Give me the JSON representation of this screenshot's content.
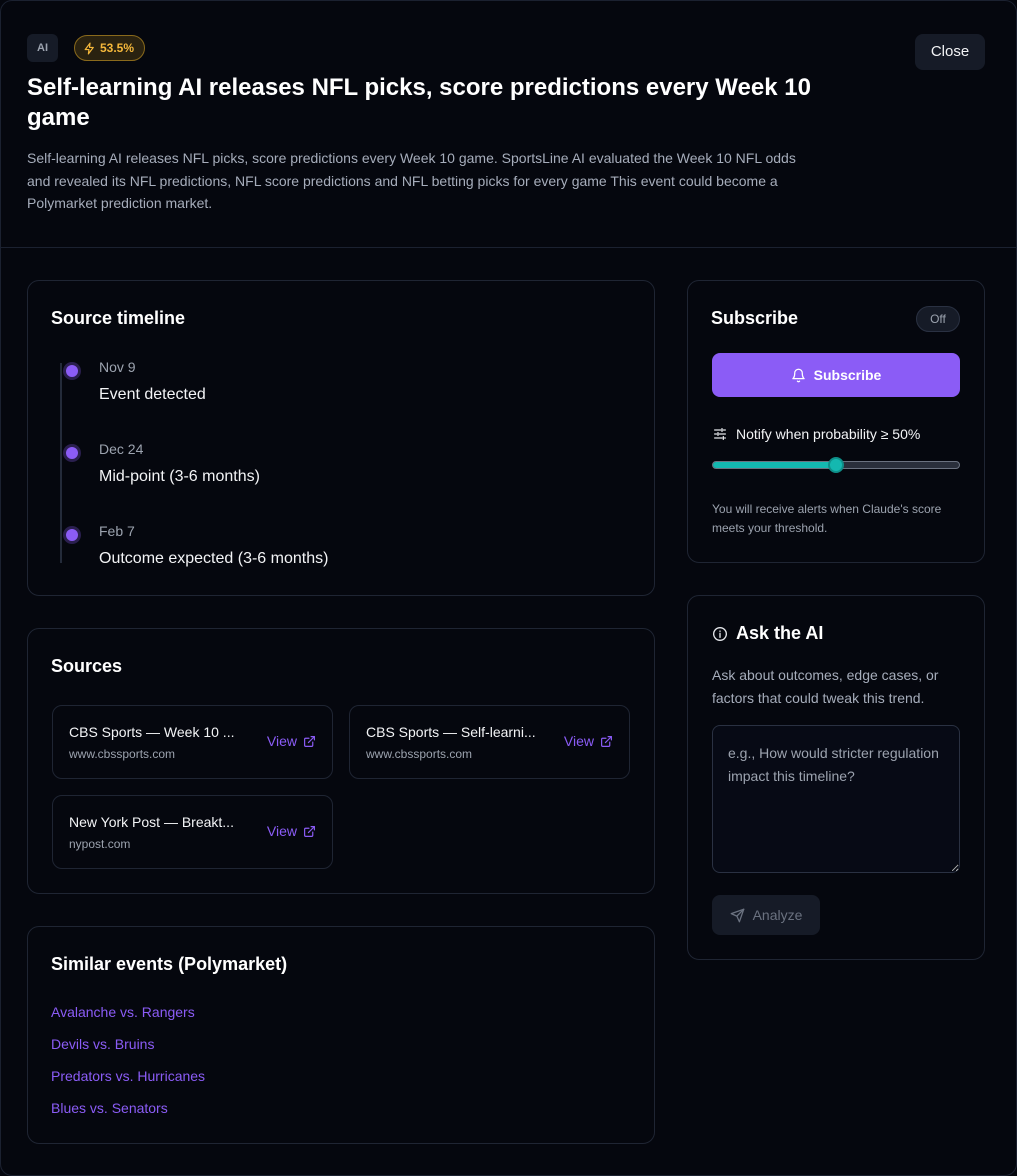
{
  "header": {
    "tag": "AI",
    "probability": "53.5%",
    "close_label": "Close",
    "title": "Self-learning AI releases NFL picks, score predictions every Week 10 game",
    "description": "Self-learning AI releases NFL picks, score predictions every Week 10 game. SportsLine AI evaluated the Week 10 NFL odds and revealed its NFL predictions, NFL score predictions and NFL betting picks for every game This event could become a Polymarket prediction market."
  },
  "timeline": {
    "title": "Source timeline",
    "items": [
      {
        "date": "Nov 9",
        "label": "Event detected"
      },
      {
        "date": "Dec 24",
        "label": "Mid-point (3-6 months)"
      },
      {
        "date": "Feb 7",
        "label": "Outcome expected (3-6 months)"
      }
    ]
  },
  "sources": {
    "title": "Sources",
    "items": [
      {
        "name": "CBS Sports — Week 10 ...",
        "domain": "www.cbssports.com",
        "view": "View"
      },
      {
        "name": "CBS Sports — Self-learni...",
        "domain": "www.cbssports.com",
        "view": "View"
      },
      {
        "name": "New York Post — Breakt...",
        "domain": "nypost.com",
        "view": "View"
      }
    ]
  },
  "similar": {
    "title": "Similar events (Polymarket)",
    "items": [
      "Avalanche vs. Rangers",
      "Devils vs. Bruins",
      "Predators vs. Hurricanes",
      "Blues vs. Senators"
    ]
  },
  "subscribe": {
    "title": "Subscribe",
    "toggle": "Off",
    "button": "Subscribe",
    "notify": "Notify when probability ≥ 50%",
    "threshold_percent": 50,
    "note": "You will receive alerts when Claude's score meets your threshold."
  },
  "ask": {
    "title": "Ask the AI",
    "description": "Ask about outcomes, edge cases, or factors that could tweak this trend.",
    "placeholder": "e.g., How would stricter regulation impact this timeline?",
    "button": "Analyze"
  },
  "colors": {
    "accent": "#8b5cf6",
    "slider": "#14b8b0",
    "probability_badge": "#f5b83b",
    "background": "#05070e"
  }
}
